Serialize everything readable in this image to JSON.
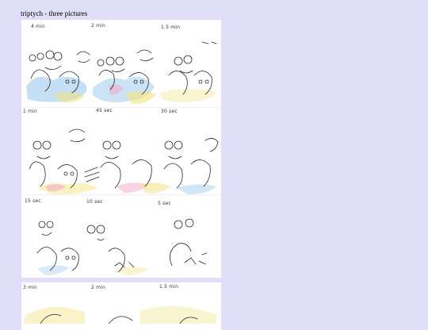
{
  "page": {
    "title": "triptych - three pictures"
  },
  "image1": {
    "row1": [
      "4 min",
      "2 min",
      "1.5 min"
    ],
    "row2": [
      "1 min",
      "45 sec",
      "30 sec"
    ],
    "row3": [
      "15 sec",
      "10 sec",
      "5 sec"
    ]
  },
  "image2": {
    "row1": [
      "3 min",
      "2 min",
      "1.5 min"
    ]
  },
  "colors": {
    "background": "#e0def8",
    "sheet": "#ffffff",
    "pencil": "#2a2a2a",
    "crayon_blue": "#7fb8e8",
    "crayon_yellow": "#f2e27a",
    "crayon_pink": "#f3a6c8"
  }
}
